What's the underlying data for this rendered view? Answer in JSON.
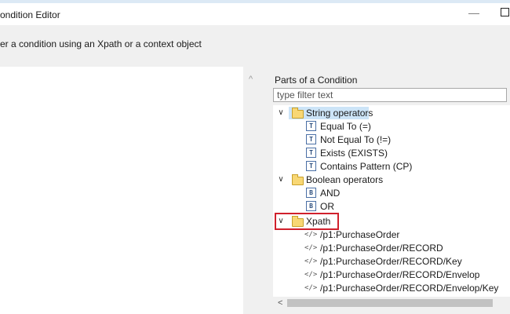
{
  "window": {
    "title": "ondition Editor"
  },
  "header": {
    "description": "er a condition using an Xpath or a context object"
  },
  "parts": {
    "label": "Parts of a Condition",
    "filter_placeholder": "type filter text",
    "groups": [
      {
        "label": "String operators",
        "expanded": true,
        "selected": true,
        "items": [
          {
            "icon": "T",
            "label": "Equal To (=)"
          },
          {
            "icon": "T",
            "label": "Not Equal To (!=)"
          },
          {
            "icon": "T",
            "label": "Exists (EXISTS)"
          },
          {
            "icon": "T",
            "label": "Contains Pattern (CP)"
          }
        ]
      },
      {
        "label": "Boolean operators",
        "expanded": true,
        "items": [
          {
            "icon": "B",
            "label": "AND"
          },
          {
            "icon": "B",
            "label": "OR"
          }
        ]
      },
      {
        "label": "Xpath",
        "expanded": true,
        "highlighted": true,
        "items": [
          {
            "icon": "</>",
            "label": "/p1:PurchaseOrder"
          },
          {
            "icon": "</>",
            "label": "/p1:PurchaseOrder/RECORD"
          },
          {
            "icon": "</>",
            "label": "/p1:PurchaseOrder/RECORD/Key"
          },
          {
            "icon": "</>",
            "label": "/p1:PurchaseOrder/RECORD/Envelop"
          },
          {
            "icon": "</>",
            "label": "/p1:PurchaseOrder/RECORD/Envelop/Key"
          }
        ]
      }
    ]
  },
  "colors": {
    "highlight": "#d0202c",
    "selection": "#cce4f7",
    "folder": "#f8d774"
  }
}
